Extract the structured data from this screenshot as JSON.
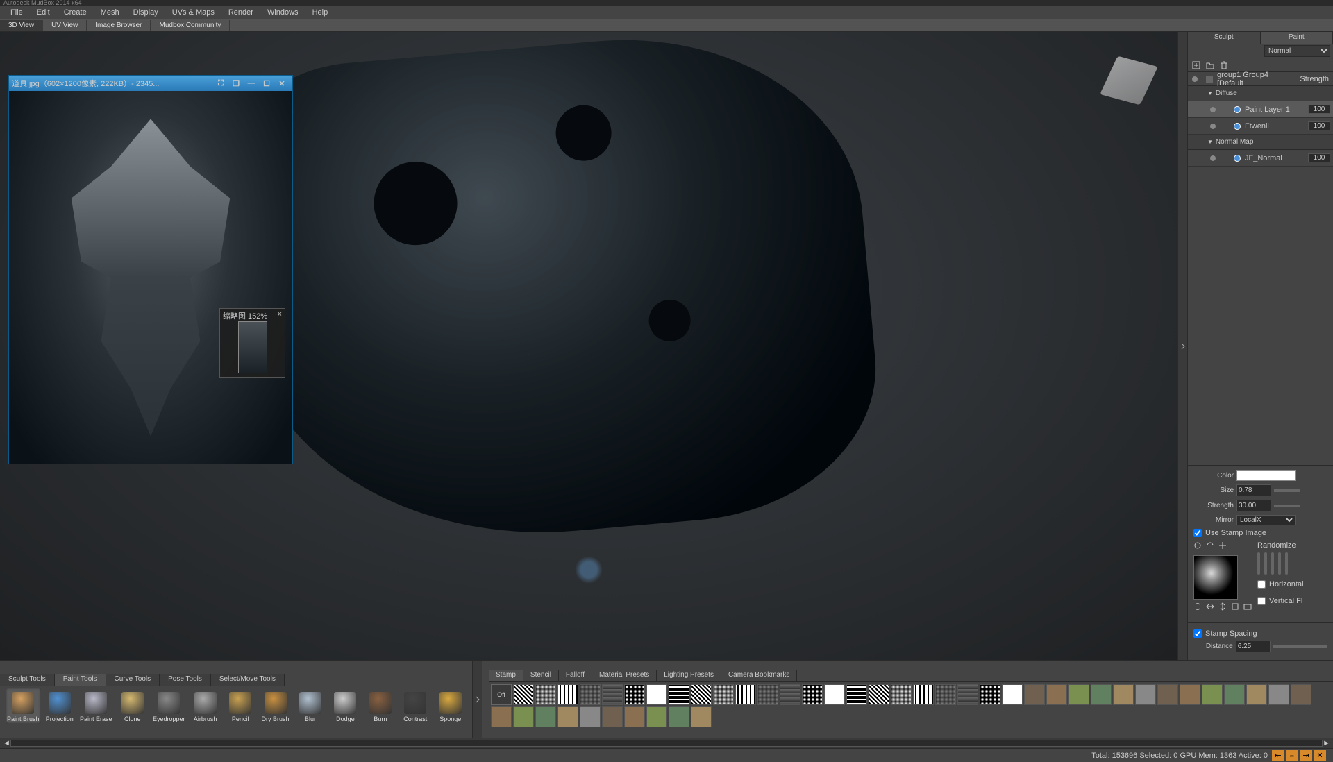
{
  "title": "Autodesk MudBox 2014 x64",
  "menus": [
    "File",
    "Edit",
    "Create",
    "Mesh",
    "Display",
    "UVs & Maps",
    "Render",
    "Windows",
    "Help"
  ],
  "viewTabs": [
    "3D View",
    "UV View",
    "Image Browser",
    "Mudbox Community"
  ],
  "refWindow": {
    "title": "道具.jpg（602×1200像素, 222KB）- 2345...",
    "navZoom": "缩略图 152%",
    "navClose": "×"
  },
  "rightPanel": {
    "tabs": [
      "Sculpt",
      "Paint"
    ],
    "blend": "Normal",
    "object": "group1 Group4 [Default",
    "strengthHeader": "Strength",
    "channels": [
      {
        "name": "Diffuse",
        "layers": [
          {
            "name": "Paint Layer 1",
            "val": "100",
            "sel": true
          },
          {
            "name": "Ftwenli",
            "val": "100"
          }
        ]
      },
      {
        "name": "Normal Map",
        "layers": [
          {
            "name": "JF_Normal",
            "val": "100"
          }
        ]
      }
    ],
    "props": {
      "colorLabel": "Color",
      "sizeLabel": "Size",
      "sizeVal": "0.78",
      "strengthLabel": "Strength",
      "strengthVal": "30.00",
      "mirrorLabel": "Mirror",
      "mirrorVal": "LocalX",
      "useStamp": "Use Stamp Image",
      "randomize": "Randomize",
      "horizontal": "Horizontal",
      "vertical": "Vertical Fl",
      "stampSpacing": "Stamp Spacing",
      "distanceLabel": "Distance",
      "distanceVal": "6.25"
    }
  },
  "toolTabs": [
    "Sculpt Tools",
    "Paint Tools",
    "Curve Tools",
    "Pose Tools",
    "Select/Move Tools"
  ],
  "tools": [
    {
      "n": "Paint Brush",
      "c": "#d4a060"
    },
    {
      "n": "Projection",
      "c": "#5090d0"
    },
    {
      "n": "Paint Erase",
      "c": "#b8b8c8"
    },
    {
      "n": "Clone",
      "c": "#d4b870"
    },
    {
      "n": "Eyedropper",
      "c": "#888"
    },
    {
      "n": "Airbrush",
      "c": "#aaa"
    },
    {
      "n": "Pencil",
      "c": "#c8a050"
    },
    {
      "n": "Dry Brush",
      "c": "#c89040"
    },
    {
      "n": "Blur",
      "c": "#b0c0d0"
    },
    {
      "n": "Dodge",
      "c": "#ccc"
    },
    {
      "n": "Burn",
      "c": "#886040"
    },
    {
      "n": "Contrast",
      "c": "#444"
    },
    {
      "n": "Sponge",
      "c": "#d8a840"
    }
  ],
  "stampTabs": [
    "Stamp",
    "Stencil",
    "Falloff",
    "Material Presets",
    "Lighting Presets",
    "Camera Bookmarks"
  ],
  "stampOff": "Off",
  "status": "Total: 153696  Selected: 0 GPU Mem: 1363  Active: 0"
}
